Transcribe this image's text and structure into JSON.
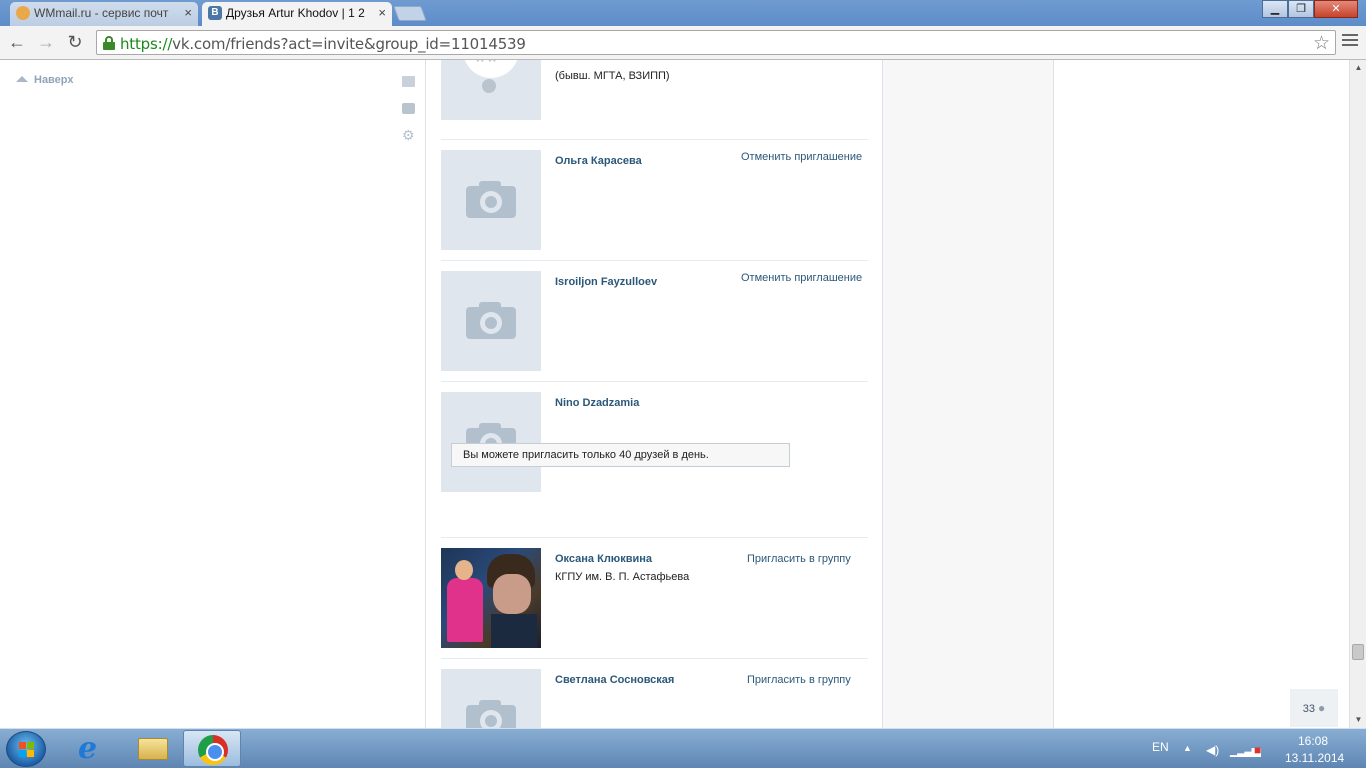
{
  "browser": {
    "tabs": [
      {
        "title": "WMmail.ru - сервис почт",
        "close": "×",
        "favicon_color": "#e9a94a"
      },
      {
        "title": "Друзья Artur Khodov | 1 2",
        "close": "×",
        "favicon_color": "#4a76a8",
        "favicon_letter": "B"
      }
    ],
    "window_controls": {
      "minimize": "▁",
      "maximize": "❐",
      "close": "✕"
    },
    "nav": {
      "back": "←",
      "forward": "→",
      "reload": "↻"
    },
    "url_scheme": "https://",
    "url_rest": "vk.com/friends?act=invite&group_id=11014539",
    "star": "☆"
  },
  "sidebar": {
    "up_label": "Наверх",
    "icons": [
      "envelope-icon",
      "comment-icon",
      "gear-icon"
    ]
  },
  "friends": {
    "partial_row": {
      "sub_line2": "(бывш. МГТА, ВЗИПП)"
    },
    "rows": [
      {
        "name": "Ольга Карасева",
        "action": "Отменить приглашение",
        "sub": ""
      },
      {
        "name": "Isroiljon Fayzulloev",
        "action": "Отменить приглашение",
        "sub": ""
      },
      {
        "name": "Nino Dzadzamia",
        "action": "",
        "sub": ""
      },
      {
        "name": "Оксана Клюквина",
        "action": "Пригласить в группу",
        "sub": "КГПУ им. В. П. Астафьева"
      },
      {
        "name": "Светлана Сосновская",
        "action": "Пригласить в группу",
        "sub": ""
      }
    ],
    "limit_notice": "Вы можете пригласить только 40 друзей в день."
  },
  "online_counter": {
    "count": "33",
    "icon": "person-icon"
  },
  "taskbar": {
    "lang": "EN",
    "time": "16:08",
    "date": "13.11.2014",
    "apps": [
      "internet-explorer",
      "file-explorer",
      "chrome"
    ]
  },
  "colors": {
    "link": "#2b587a",
    "taskbar": "#5e86b3",
    "url_green": "#1a8a1a"
  }
}
